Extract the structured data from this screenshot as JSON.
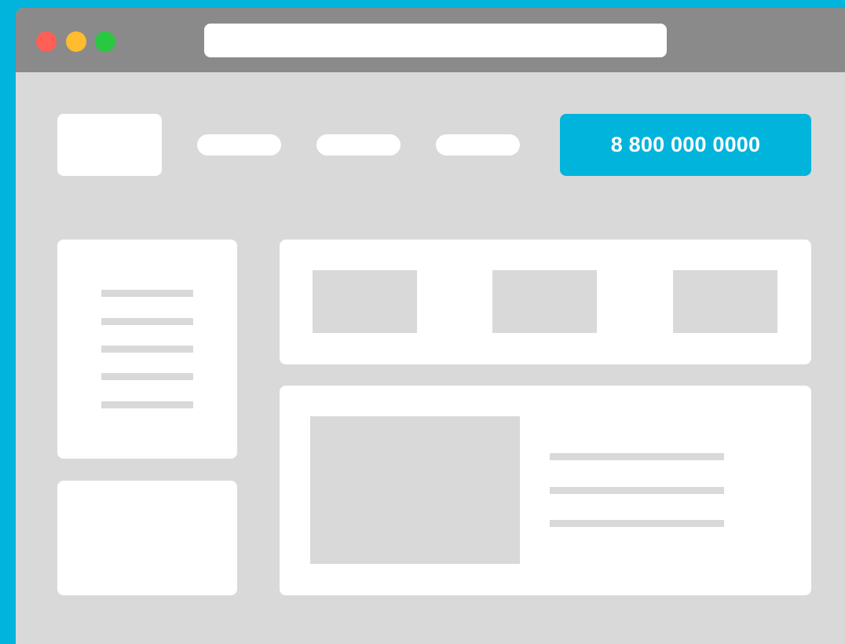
{
  "colors": {
    "background": "#00b4dc",
    "accent": "#00b4dc",
    "window_close": "#ff5f57",
    "window_minimize": "#febc2e",
    "window_maximize": "#28c840"
  },
  "header": {
    "phone_button_label": "8 800 000 0000"
  }
}
